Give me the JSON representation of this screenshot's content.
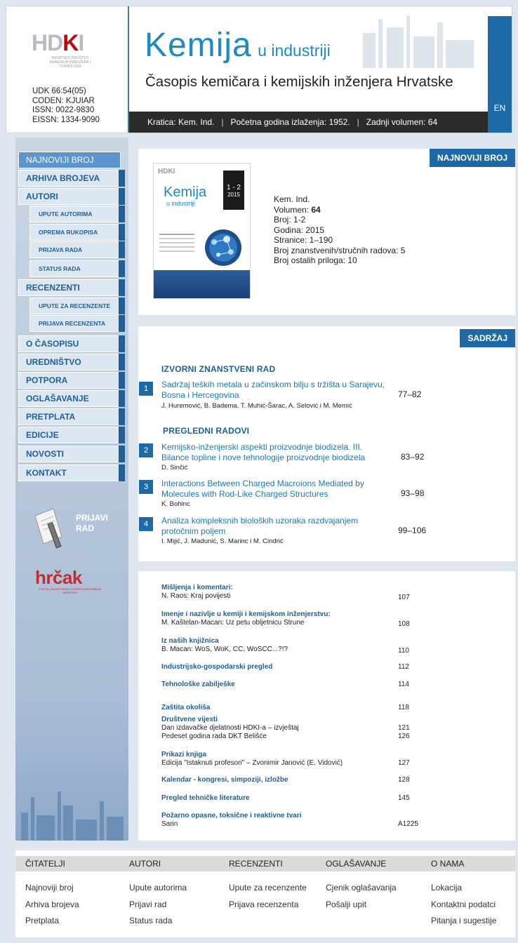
{
  "header": {
    "logo_text": "HDKI",
    "logo_sub": "HRVATSKO DRUŠTVO KEMIJSKIH INŽENJERA I TEHNOLOGA",
    "udk": "UDK 66:54(05)",
    "coden": "CODEN: KJUIAR",
    "issn": "ISSN: 0022-9830",
    "eissn": "EISSN: 1334-9090",
    "title_big": "Kemija",
    "title_small": "u industriji",
    "subtitle": "Časopis kemičara i kemijskih inženjera Hrvatske",
    "info_kratica": "Kratica: Kem. Ind.",
    "info_pocetna": "Početna godina izlaženja: 1952.",
    "info_volumen": "Zadnji volumen: 64",
    "lang_button": "EN"
  },
  "sidebar": {
    "items": [
      {
        "label": "NAJNOVIJI BROJ"
      },
      {
        "label": "ARHIVA BROJEVA"
      },
      {
        "label": "AUTORI"
      },
      {
        "label": "UPUTE AUTORIMA"
      },
      {
        "label": "OPREMA RUKOPISA"
      },
      {
        "label": "PRIJAVA RADA"
      },
      {
        "label": "STATUS RADA"
      },
      {
        "label": "RECENZENTI"
      },
      {
        "label": "UPUTE ZA RECENZENTE"
      },
      {
        "label": "PRIJAVA RECENZENTA"
      },
      {
        "label": "O ČASOPISU"
      },
      {
        "label": "UREDNIŠTVO"
      },
      {
        "label": "POTPORA"
      },
      {
        "label": "OGLAŠAVANJE"
      },
      {
        "label": "PRETPLATA"
      },
      {
        "label": "EDICIJE"
      },
      {
        "label": "NOVOSTI"
      },
      {
        "label": "KONTAKT"
      }
    ],
    "prijavi_line1": "PRIJAVI",
    "prijavi_line2": "RAD",
    "hrcak_logo": "hrčak",
    "hrcak_sub": "PORTAL ZNANSTVENIH ČASOPISA REPUBLIKE HRVATSKE"
  },
  "issue": {
    "tag": "NAJNOVIJI BROJ",
    "cover_title": "Kemija",
    "cover_subtitle": "u industriji",
    "cover_issue": "1 - 2",
    "cover_year": "2015",
    "kem_ind": "Kem. Ind.",
    "volumen_label": "Volumen: ",
    "volumen_value": "64",
    "broj": "Broj: 1-2",
    "godina": "Godina: 2015",
    "stranice": "Stranice: 1–190",
    "znanstveni": "Broj znanstvenih/stručnih radova: 5",
    "ostali": "Broj ostalih priloga: 10"
  },
  "contents": {
    "tag": "SADRŽAJ",
    "sec1": "IZVORNI ZNANSTVENI RAD",
    "sec2": "PREGLEDNI RADOVI",
    "articles": [
      {
        "num": "1",
        "title": "Sadržaj teških metala u začinskom bilju s tržišta u Sarajevu, Bosna i Hercegovina",
        "authors": "J. Huremović, B. Badema, T. Muhić-Šarac, A. Selović i M. Memić",
        "pages": "77–82"
      },
      {
        "num": "2",
        "title": "Kemijsko-inženjerski aspekti proizvodnje biodizela. III. Bilance topline i nove tehnologije proizvodnje biodizela",
        "authors": "D. Sinčić",
        "pages": "83–92"
      },
      {
        "num": "3",
        "title": "Interactions Between Charged Macroions Mediated by Molecules with Rod-Like Charged Structures",
        "authors": "K. Bohinc",
        "pages": "93–98"
      },
      {
        "num": "4",
        "title": "Analiza kompleksnih bioloških uzoraka razdvajanjem protočnim poljem",
        "authors": "I. Mijić, J. Madunić, S. Marinc i M. Cindrić",
        "pages": "99–106"
      }
    ]
  },
  "misc": [
    {
      "title": "Mišljenja i komentari:",
      "line": "N. Raos: Kraj povijesti",
      "page": "107"
    },
    {
      "title": "Imenje i nazivlje u kemiji i kemijskom inženjerstvu:",
      "line": "M. Kaštelan-Macan: Uz petu obljetnicu Strune",
      "page": "108"
    },
    {
      "title": "Iz naših knjižnica",
      "line": "B. Macan: WoS, WoK, CC, WoSCC...?!?",
      "page": "110"
    },
    {
      "title": "Industrijsko-gospodarski pregled",
      "page": "112"
    },
    {
      "title": "Tehnološke zabilješke",
      "page": "114"
    },
    {
      "title": "Zaštita okoliša",
      "page": "118"
    },
    {
      "title": "Društvene vijesti",
      "line": "Dan izdavačke djelatnosti HDKI-a – izvještaj",
      "page": "121",
      "line2": "Pedeset godina rada DKT Belišće",
      "page2": "126"
    },
    {
      "title": "Prikazi knjiga",
      "line": "Edicija \"Istaknuti profesori\" – Zvonimir Janović (E. Vidović)",
      "page": "127"
    },
    {
      "title": "Kalendar - kongresi, simpoziji, izložbe",
      "page": "128"
    },
    {
      "title": "Pregled tehničke literature",
      "page": "145"
    },
    {
      "title": "Požarno opasne, toksične i reaktivne tvari",
      "line": "Sarin",
      "page": "A1225"
    }
  ],
  "footer": {
    "cols": [
      {
        "head": "ČITATELJI",
        "links": [
          "Najnoviji broj",
          "Arhiva brojeva",
          "Pretplata"
        ]
      },
      {
        "head": "AUTORI",
        "links": [
          "Upute autorima",
          "Prijavi rad",
          "Status rada"
        ]
      },
      {
        "head": "RECENZENTI",
        "links": [
          "Upute za recenzente",
          "Prijava recenzenta"
        ]
      },
      {
        "head": "OGLAŠAVANJE",
        "links": [
          "Cjenik oglašavanja",
          "Pošalji upit"
        ]
      },
      {
        "head": "O NAMA",
        "links": [
          "Lokacija",
          "Kontaktni podatci",
          "Pitanja i sugestije"
        ]
      }
    ]
  },
  "colors": {
    "accent": "#1d6aa7",
    "brand": "#1c8ac4",
    "sidebar": "#a9bdd6"
  }
}
